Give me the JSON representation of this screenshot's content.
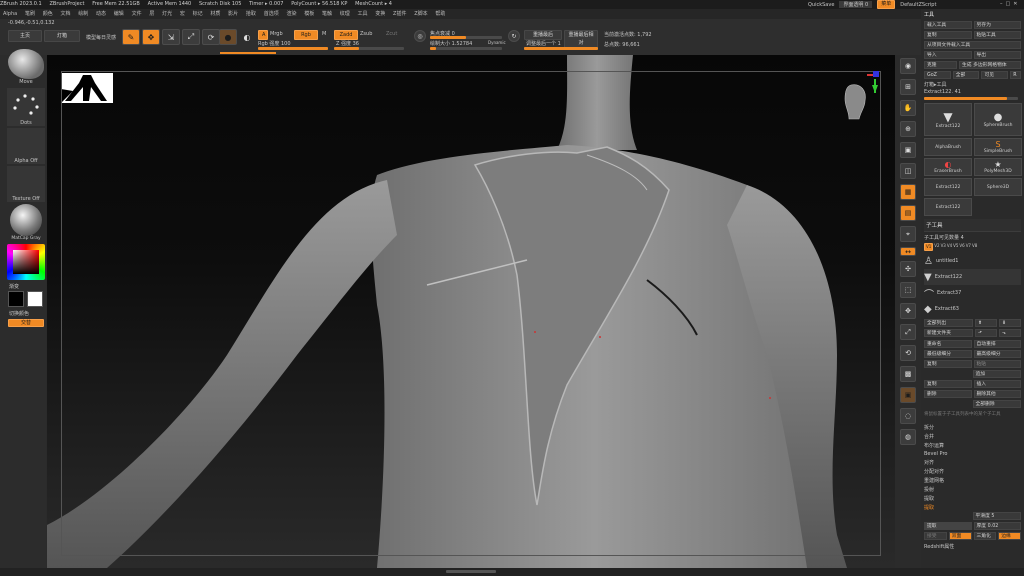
{
  "titlebar": {
    "app": "ZBrush 2023.0.1",
    "project": "ZBrushProject",
    "free_mem": "Free Mem 22.51GB",
    "active_mem": "Active Mem 1440",
    "scratch": "Scratch Disk 105",
    "timer": "Timer ▸ 0.007",
    "polycount": "PolyCount ▸ 56.518 KP",
    "meshcount": "MeshCount ▸ 4",
    "quicksave": "QuickSave",
    "interface_transparency": "界面透明 0",
    "menus_btn": "菜单",
    "default_script": "DefaultZScript"
  },
  "menubar": [
    "Alpha",
    "笔刷",
    "颜色",
    "文档",
    "绘制",
    "动态",
    "编辑",
    "文件",
    "层",
    "灯光",
    "宏",
    "标记",
    "材质",
    "影片",
    "拾取",
    "首选项",
    "渲染",
    "模板",
    "笔触",
    "纹理",
    "工具",
    "变换",
    "Z插件",
    "Z脚本",
    "帮助"
  ],
  "coords": "-0.946,-0.51,0.132",
  "toolbar": {
    "home_tab": "主页",
    "lightbox_tab": "灯箱",
    "tutorial": "模型每日灵感",
    "edit_icon_label": "Edit",
    "draw_icon_label": "Draw",
    "move_icon_label": "Move",
    "scale_icon_label": "Scale",
    "rotate_icon_label": "Rotate",
    "a_btn": "A",
    "mrgb": "Mrgb",
    "rgb": "Rgb",
    "m": "M",
    "rgb_intensity": "Rgb 强度 100",
    "zadd": "Zadd",
    "zsub": "Zsub",
    "zcut": "Zcut",
    "z_intensity": "Z 强度 36",
    "focal_shift": "焦点衰减 0",
    "draw_size": "绘制大小 1.52784",
    "dynamic": "Dynamic",
    "replay_last": "重播最后",
    "replay_last_rel": "重播最后相对",
    "adjust_last": "调整最后一个 1",
    "active_points": "当前激活点数: 1,792",
    "total_points": "总点数: 96,661"
  },
  "left": {
    "brush_label": "Move",
    "stroke_label": "Dots",
    "alpha_label": "Alpha Off",
    "texture_label": "Texture Off",
    "material_label": "MatCap Gray",
    "gradient_label": "渐变",
    "switch_color": "切换颜色",
    "alternate": "交替"
  },
  "right_icons": [
    "Bpr",
    "子像素",
    "Scroll",
    "Zoom",
    "Actual",
    "AAHalf",
    "透视",
    "地面",
    "Local",
    "L.Sym",
    "XYZ",
    "Frame",
    "Move",
    "Scale",
    "Rotate",
    "PolyF",
    "Transp",
    "Ghost",
    "Solo",
    "Xpose"
  ],
  "tool_panel": {
    "title": "工具",
    "load_tool": "载入工具",
    "save_as": "另存为",
    "copy": "复制",
    "paste_tool": "粘贴工具",
    "import_btn": "导入",
    "export_btn": "导出",
    "from_project": "从项目文件载入工具",
    "clone": "克隆",
    "make_polymesh": "生成 多边形网格物体",
    "goz": "GoZ",
    "all": "全部",
    "visible": "可见",
    "r": "R",
    "lightbox_tools": "灯箱▸工具",
    "current_tool": "Extract122. 41",
    "tools": [
      "Extract122",
      "SphereBrush",
      "AlphaBrush",
      "SimpleBrush",
      "EraserBrush",
      "PolyMesh3D",
      "Extract122",
      "Sphere3D",
      "Extract122"
    ],
    "subtool_title": "子工具",
    "subtool_count": "子工具可见数量 4",
    "subtool_tabs": [
      "V1",
      "V2",
      "V3",
      "V4",
      "V5",
      "V6",
      "V7",
      "V8"
    ],
    "subtools": [
      "untitled1",
      "Extract122",
      "Extract37",
      "Extract63"
    ],
    "list_all": "全部列出",
    "new_folder": "新建文件夹",
    "rename": "重命名",
    "auto_reorder": "自动重排",
    "all_low": "最低级细分",
    "all_high": "最高级细分",
    "copy_sub": "复制",
    "paste_sub": "粘贴",
    "append": "追加",
    "insert": "插入",
    "duplicate": "复制",
    "delete": "删除",
    "del_other": "删除其他",
    "del_all": "全部删除",
    "hint": "将鼠标置于子工具列表中的某个子工具",
    "items": [
      "拆分",
      "合并",
      "布尔运算",
      "Bevel Pro",
      "对齐",
      "分配对齐",
      "重建网格",
      "投射",
      "提取"
    ],
    "extract_btn": "提取",
    "smooth": "平滑度 5",
    "thickness": "厚度 0.02",
    "accept": "接受",
    "double": "双面",
    "tcorner": "三角化",
    "border": "边缘",
    "redshift": "Redshift属性"
  }
}
